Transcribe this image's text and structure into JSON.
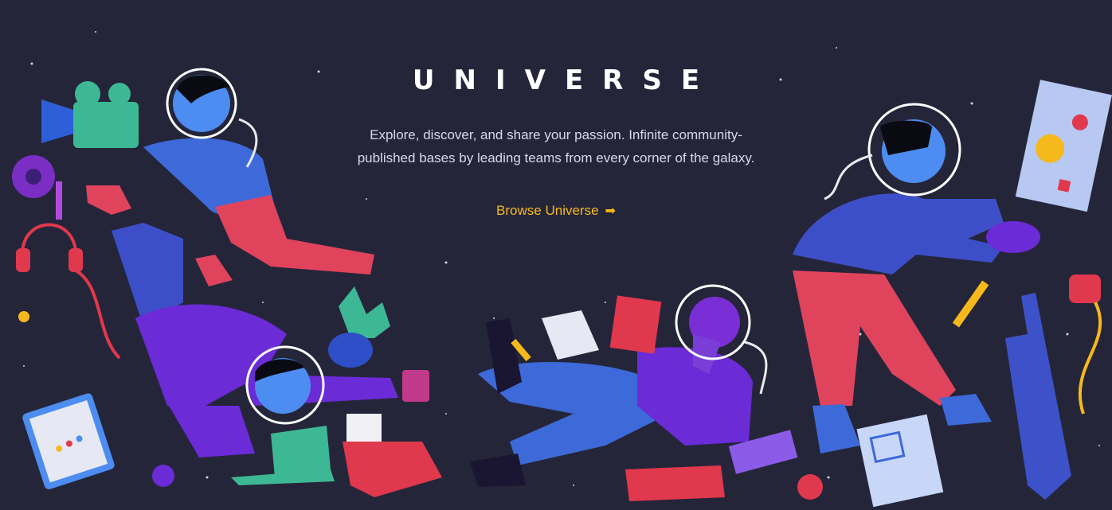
{
  "hero": {
    "title": "UNIVERSE",
    "description": "Explore, discover, and share your passion. Infinite community-published bases by leading teams from every corner of the galaxy.",
    "cta_label": "Browse Universe",
    "cta_arrow": "➡"
  },
  "colors": {
    "background": "#25253a",
    "title": "#ffffff",
    "text": "#d8d8e6",
    "accent": "#f5b91c"
  },
  "illustration": {
    "icons": [
      "film-camera-icon",
      "film-reel-icon",
      "headphones-icon",
      "sneaker-icon",
      "potted-plant-icon",
      "coffee-mug-icon",
      "laptop-icon",
      "typewriter-icon",
      "clipboard-icon",
      "book-icon",
      "paper-icon",
      "pencil-icon",
      "painting-canvas-icon",
      "paint-palette-icon",
      "tape-measure-icon",
      "skyscraper-icon",
      "blueprint-icon",
      "planet-icon"
    ]
  }
}
